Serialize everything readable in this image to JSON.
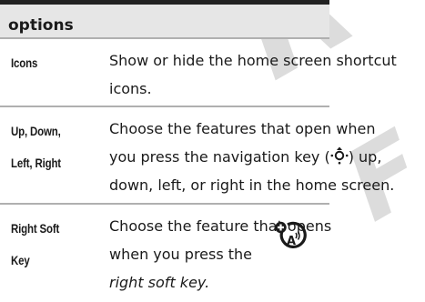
{
  "header": {
    "title": "options"
  },
  "rows": [
    {
      "term": [
        "Icons"
      ],
      "desc": [
        "Show or hide the home screen shortcut",
        "icons."
      ]
    },
    {
      "term": [
        "Up, Down,",
        "Left, Right"
      ],
      "desc_line1": "Choose the features that open when",
      "desc_line2_pre": "you press the navigation key (",
      "desc_line2_post": ") up,",
      "desc_line3": "down, left, or right in the home screen.",
      "nav_icon": "navigation-key-icon"
    },
    {
      "term": [
        "Right Soft",
        "Key"
      ],
      "desc": [
        "Choose the feature that opens",
        "when you press the",
        "right soft key."
      ],
      "icon": "network-feature-icon"
    }
  ]
}
